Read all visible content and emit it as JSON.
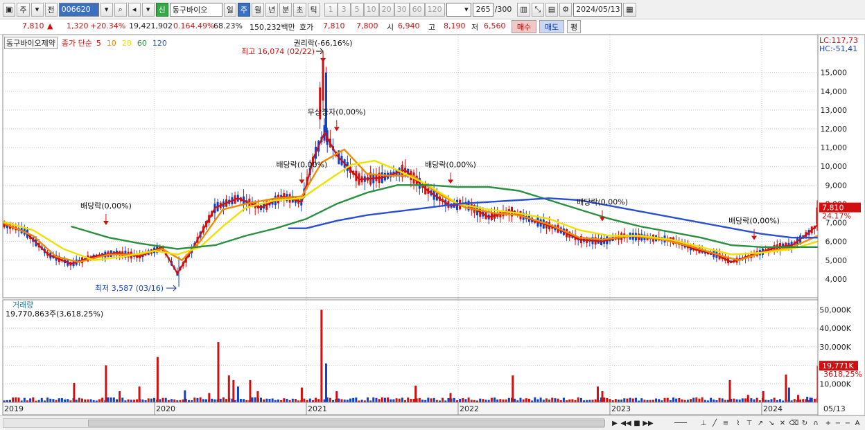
{
  "toolbar": {
    "market_label": "주",
    "prev_label": "전",
    "stock_code": "006620",
    "badge_new": "신",
    "stock_name": "동구바이오",
    "periods": [
      "일",
      "주",
      "월",
      "년",
      "분",
      "초",
      "틱"
    ],
    "selected_period": "주",
    "intervals": [
      "1",
      "3",
      "5",
      "10",
      "20",
      "30",
      "60",
      "120"
    ],
    "count": "265",
    "count_total": "/300",
    "date": "2024/05/13"
  },
  "quote": {
    "price": "7,810",
    "arrow": "▲",
    "change": "1,320",
    "change_pct": "+20.34%",
    "volume": "19,421,902",
    "volume_ratio": "0.164.49%",
    "turnover": "68.23%",
    "amount": "150,232백만",
    "hoga_label": "호가",
    "ask": "7,810",
    "bid": "7,800",
    "open_label": "시",
    "open": "6,940",
    "high_label": "고",
    "high": "8,190",
    "low_label": "저",
    "low": "6,560",
    "buy_label": "매수",
    "sell_label": "매도",
    "eval_label": "평"
  },
  "legend": {
    "stock_name": "동구바이오제약",
    "ma_title": "종가 단순",
    "ma_periods": [
      "5",
      "10",
      "20",
      "60",
      "120"
    ]
  },
  "colors": {
    "up": "#d01010",
    "down": "#1040c8",
    "ma5": "#d01010",
    "ma10": "#f08a00",
    "ma20": "#f0e000",
    "ma60": "#2a9040",
    "ma120": "#2a50d0",
    "accent": "#3b6fbf",
    "grid": "#c8c8c8"
  },
  "chart_data": [
    {
      "type": "candlestick",
      "ylim": [
        3000,
        16500
      ],
      "y_ticks": [
        "4,000",
        "5,000",
        "6,000",
        "7,000",
        "8,000",
        "9,000",
        "10,000",
        "11,000",
        "12,000",
        "13,000",
        "14,000",
        "15,000"
      ],
      "y_tick_values": [
        4000,
        5000,
        6000,
        7000,
        8000,
        9000,
        10000,
        11000,
        12000,
        13000,
        14000,
        15000
      ],
      "x_labels": [
        "2019",
        "2020",
        "2021",
        "2022",
        "2023",
        "2024"
      ],
      "x_label_positions": [
        2019.0,
        2020.0,
        2021.0,
        2022.0,
        2023.0,
        2024.0
      ],
      "x_range": [
        2019.0,
        2024.37
      ],
      "last_date_label": "05/13",
      "right_labels": {
        "lc": "LC:117,73",
        "hc": "HC:-51,41"
      },
      "last_price_label": "7,810",
      "last_change_label": "24.17%",
      "series": [
        {
          "name": "5",
          "points": [
            [
              2019.0,
              6950
            ],
            [
              2019.15,
              6500
            ],
            [
              2019.3,
              5300
            ],
            [
              2019.45,
              4800
            ],
            [
              2019.6,
              5200
            ],
            [
              2019.75,
              5400
            ],
            [
              2019.9,
              5200
            ],
            [
              2020.05,
              5700
            ],
            [
              2020.15,
              4300
            ],
            [
              2020.25,
              5600
            ],
            [
              2020.4,
              7800
            ],
            [
              2020.55,
              8300
            ],
            [
              2020.7,
              7800
            ],
            [
              2020.85,
              8400
            ],
            [
              2020.97,
              8100
            ],
            [
              2021.05,
              10500
            ],
            [
              2021.12,
              11800
            ],
            [
              2021.2,
              10600
            ],
            [
              2021.35,
              9300
            ],
            [
              2021.5,
              9400
            ],
            [
              2021.65,
              9800
            ],
            [
              2021.8,
              8700
            ],
            [
              2021.95,
              7900
            ],
            [
              2022.05,
              8000
            ],
            [
              2022.2,
              7300
            ],
            [
              2022.35,
              7600
            ],
            [
              2022.5,
              7100
            ],
            [
              2022.65,
              6700
            ],
            [
              2022.8,
              6100
            ],
            [
              2022.95,
              6000
            ],
            [
              2023.1,
              6300
            ],
            [
              2023.25,
              6200
            ],
            [
              2023.4,
              6100
            ],
            [
              2023.55,
              5600
            ],
            [
              2023.7,
              5300
            ],
            [
              2023.8,
              4900
            ],
            [
              2023.95,
              5300
            ],
            [
              2024.1,
              5700
            ],
            [
              2024.2,
              5800
            ],
            [
              2024.3,
              6400
            ],
            [
              2024.37,
              6900
            ]
          ]
        },
        {
          "name": "10",
          "points": [
            [
              2019.0,
              7000
            ],
            [
              2019.2,
              6300
            ],
            [
              2019.35,
              5200
            ],
            [
              2019.5,
              4900
            ],
            [
              2019.7,
              5300
            ],
            [
              2019.9,
              5300
            ],
            [
              2020.05,
              5600
            ],
            [
              2020.18,
              5000
            ],
            [
              2020.3,
              6000
            ],
            [
              2020.45,
              7700
            ],
            [
              2020.6,
              8000
            ],
            [
              2020.8,
              8300
            ],
            [
              2020.97,
              8400
            ],
            [
              2021.1,
              10200
            ],
            [
              2021.25,
              10900
            ],
            [
              2021.4,
              9600
            ],
            [
              2021.55,
              9500
            ],
            [
              2021.7,
              9500
            ],
            [
              2021.9,
              8400
            ],
            [
              2022.05,
              7800
            ],
            [
              2022.25,
              7500
            ],
            [
              2022.4,
              7400
            ],
            [
              2022.6,
              6900
            ],
            [
              2022.8,
              6200
            ],
            [
              2022.95,
              6100
            ],
            [
              2023.15,
              6300
            ],
            [
              2023.35,
              6100
            ],
            [
              2023.55,
              5700
            ],
            [
              2023.75,
              5200
            ],
            [
              2023.85,
              5000
            ],
            [
              2024.0,
              5400
            ],
            [
              2024.2,
              5700
            ],
            [
              2024.37,
              6300
            ]
          ]
        },
        {
          "name": "20",
          "points": [
            [
              2019.0,
              7050
            ],
            [
              2019.2,
              6600
            ],
            [
              2019.4,
              5600
            ],
            [
              2019.6,
              5000
            ],
            [
              2019.8,
              5200
            ],
            [
              2020.0,
              5500
            ],
            [
              2020.15,
              5300
            ],
            [
              2020.3,
              5700
            ],
            [
              2020.45,
              6800
            ],
            [
              2020.6,
              7800
            ],
            [
              2020.8,
              8200
            ],
            [
              2020.97,
              8300
            ],
            [
              2021.15,
              9300
            ],
            [
              2021.3,
              10100
            ],
            [
              2021.45,
              10300
            ],
            [
              2021.6,
              9800
            ],
            [
              2021.8,
              9000
            ],
            [
              2022.0,
              8000
            ],
            [
              2022.2,
              7700
            ],
            [
              2022.4,
              7500
            ],
            [
              2022.6,
              7200
            ],
            [
              2022.8,
              6600
            ],
            [
              2023.0,
              6300
            ],
            [
              2023.2,
              6300
            ],
            [
              2023.4,
              6100
            ],
            [
              2023.6,
              5700
            ],
            [
              2023.8,
              5300
            ],
            [
              2024.0,
              5400
            ],
            [
              2024.2,
              5600
            ],
            [
              2024.37,
              6000
            ]
          ]
        },
        {
          "name": "60",
          "points": [
            [
              2019.45,
              6800
            ],
            [
              2019.7,
              6200
            ],
            [
              2019.9,
              5900
            ],
            [
              2020.15,
              5600
            ],
            [
              2020.4,
              5800
            ],
            [
              2020.6,
              6300
            ],
            [
              2020.8,
              6700
            ],
            [
              2021.0,
              7200
            ],
            [
              2021.2,
              8000
            ],
            [
              2021.4,
              8600
            ],
            [
              2021.6,
              9000
            ],
            [
              2021.8,
              9000
            ],
            [
              2022.0,
              8900
            ],
            [
              2022.2,
              8900
            ],
            [
              2022.4,
              8700
            ],
            [
              2022.6,
              8200
            ],
            [
              2022.8,
              7700
            ],
            [
              2023.0,
              7200
            ],
            [
              2023.2,
              6800
            ],
            [
              2023.4,
              6500
            ],
            [
              2023.6,
              6200
            ],
            [
              2023.8,
              5800
            ],
            [
              2024.0,
              5700
            ],
            [
              2024.2,
              5700
            ],
            [
              2024.37,
              5700
            ]
          ]
        },
        {
          "name": "120",
          "points": [
            [
              2020.88,
              6700
            ],
            [
              2021.0,
              6700
            ],
            [
              2021.2,
              7100
            ],
            [
              2021.4,
              7400
            ],
            [
              2021.6,
              7600
            ],
            [
              2021.8,
              7800
            ],
            [
              2022.0,
              8000
            ],
            [
              2022.2,
              8100
            ],
            [
              2022.4,
              8200
            ],
            [
              2022.6,
              8300
            ],
            [
              2022.8,
              8200
            ],
            [
              2023.0,
              7900
            ],
            [
              2023.2,
              7600
            ],
            [
              2023.4,
              7300
            ],
            [
              2023.6,
              7000
            ],
            [
              2023.8,
              6700
            ],
            [
              2024.0,
              6400
            ],
            [
              2024.2,
              6200
            ],
            [
              2024.37,
              6200
            ]
          ]
        }
      ],
      "annotations": [
        {
          "text": "최고 16,074 (02/22)",
          "x": 2021.11,
          "y": 16074
        },
        {
          "text": "최저 3,587 (03/16)",
          "x": 2020.16,
          "y": 3587
        },
        {
          "text": "권리락(-66,16%)",
          "x": 2021.11,
          "y": 16074
        },
        {
          "text": "배당락(0,00%)",
          "x": 2019.68,
          "y": 6800
        },
        {
          "text": "배당락(0,00%)",
          "x": 2020.97,
          "y": 9000
        },
        {
          "text": "무상증자(0,00%)",
          "x": 2021.2,
          "y": 11800
        },
        {
          "text": "배당락(0,00%)",
          "x": 2021.95,
          "y": 9000
        },
        {
          "text": "배당락(0,00%)",
          "x": 2022.95,
          "y": 7000
        },
        {
          "text": "배당락(0,00%)",
          "x": 2023.95,
          "y": 6000
        }
      ]
    },
    {
      "type": "bar",
      "title": "거래량",
      "subtitle": "19,770,863주(3,618,25%)",
      "ylim": [
        0,
        52000
      ],
      "y_ticks": [
        "10,000K",
        "20,000K",
        "30,000K",
        "40,000K",
        "50,000K"
      ],
      "y_tick_values": [
        10000,
        20000,
        30000,
        40000,
        50000
      ],
      "last_volume_label": "19,771K",
      "last_volume_pct": "3618,25%",
      "spikes": [
        {
          "x": 2019.47,
          "value": 10500,
          "dir": "up"
        },
        {
          "x": 2019.68,
          "value": 20000,
          "dir": "up"
        },
        {
          "x": 2019.77,
          "value": 6000,
          "dir": "up"
        },
        {
          "x": 2019.9,
          "value": 8500,
          "dir": "up"
        },
        {
          "x": 2020.02,
          "value": 24500,
          "dir": "up"
        },
        {
          "x": 2020.2,
          "value": 6500,
          "dir": "down"
        },
        {
          "x": 2020.36,
          "value": 5000,
          "dir": "up"
        },
        {
          "x": 2020.42,
          "value": 32500,
          "dir": "up"
        },
        {
          "x": 2020.49,
          "value": 14500,
          "dir": "up"
        },
        {
          "x": 2020.52,
          "value": 12000,
          "dir": "up"
        },
        {
          "x": 2020.55,
          "value": 8500,
          "dir": "down"
        },
        {
          "x": 2020.63,
          "value": 12000,
          "dir": "up"
        },
        {
          "x": 2020.68,
          "value": 6000,
          "dir": "up"
        },
        {
          "x": 2020.97,
          "value": 8000,
          "dir": "up"
        },
        {
          "x": 2021.1,
          "value": 50000,
          "dir": "up"
        },
        {
          "x": 2021.13,
          "value": 21000,
          "dir": "down"
        },
        {
          "x": 2021.2,
          "value": 6000,
          "dir": "up"
        },
        {
          "x": 2021.72,
          "value": 9000,
          "dir": "up"
        },
        {
          "x": 2021.95,
          "value": 5000,
          "dir": "up"
        },
        {
          "x": 2022.36,
          "value": 14500,
          "dir": "up"
        },
        {
          "x": 2022.92,
          "value": 8500,
          "dir": "up"
        },
        {
          "x": 2022.95,
          "value": 6000,
          "dir": "up"
        },
        {
          "x": 2023.79,
          "value": 12000,
          "dir": "up"
        },
        {
          "x": 2023.91,
          "value": 4000,
          "dir": "up"
        },
        {
          "x": 2024.01,
          "value": 6000,
          "dir": "up"
        },
        {
          "x": 2024.16,
          "value": 15000,
          "dir": "up"
        },
        {
          "x": 2024.18,
          "value": 8000,
          "dir": "down"
        },
        {
          "x": 2024.24,
          "value": 4000,
          "dir": "up"
        },
        {
          "x": 2024.3,
          "value": 3000,
          "dir": "down"
        },
        {
          "x": 2024.32,
          "value": 2500,
          "dir": "down"
        },
        {
          "x": 2024.37,
          "value": 19771,
          "dir": "up"
        }
      ]
    }
  ]
}
